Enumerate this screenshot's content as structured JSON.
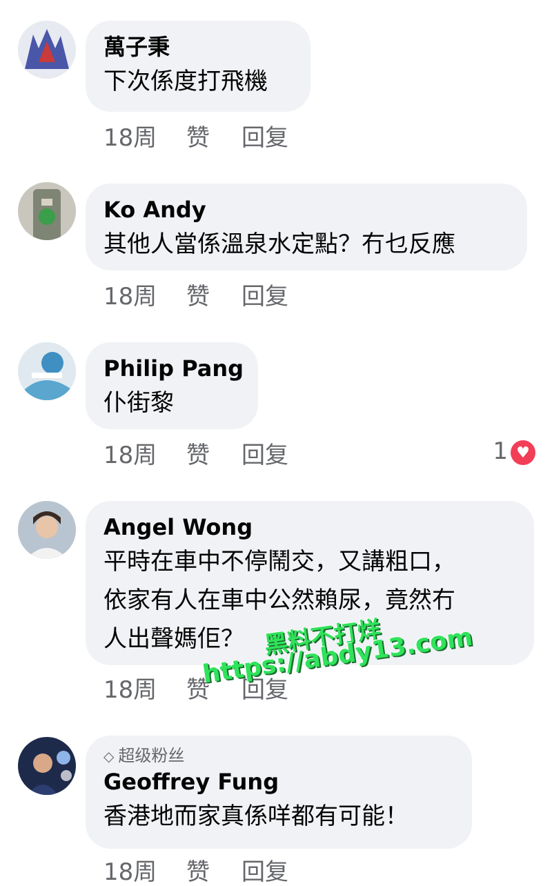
{
  "comments": [
    {
      "name": "萬子秉",
      "lines": [
        "下次係度打飛機"
      ],
      "time": "18周",
      "like": "赞",
      "reply": "回复"
    },
    {
      "name": "Ko Andy",
      "lines": [
        "其他人當係溫泉水定點？冇乜反應"
      ],
      "time": "18周",
      "like": "赞",
      "reply": "回复"
    },
    {
      "name": "Philip Pang",
      "lines": [
        "仆街黎"
      ],
      "time": "18周",
      "like": "赞",
      "reply": "回复",
      "reaction_count": "1",
      "reaction_icon": "heart-icon"
    },
    {
      "name": "Angel Wong",
      "lines": [
        "平時在車中不停鬧交，又講粗口，",
        "依家有人在車中公然賴尿，竟然冇",
        "人出聲媽佢？"
      ],
      "time": "18周",
      "like": "赞",
      "reply": "回复"
    },
    {
      "badge": "超级粉丝",
      "badge_icon": "diamond-icon",
      "name": "Geoffrey Fung",
      "lines": [
        "香港地而家真係咩都有可能！"
      ],
      "time": "18周",
      "like": "赞",
      "reply": "回复"
    }
  ],
  "watermark": {
    "line1": "黑料不打烊",
    "line2": "https://abdy13.com"
  },
  "colors": {
    "bubble": "#f0f2f5",
    "meta": "#65676b",
    "heart": "#f33e58",
    "watermark": "#2fe35a"
  }
}
